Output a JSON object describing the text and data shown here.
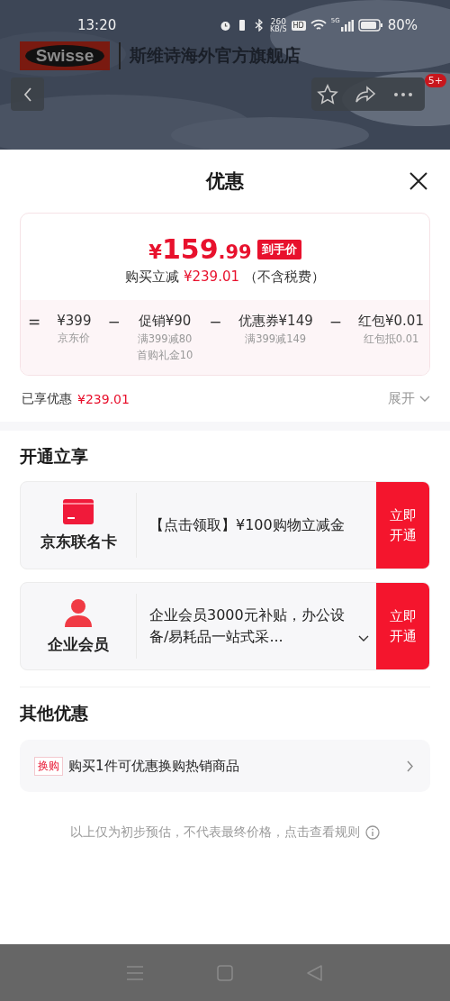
{
  "status_bar": {
    "time": "13:20",
    "network_speed": "260",
    "speed_unit": "KB/S",
    "hd": "HD",
    "network": "5G",
    "battery": "80%"
  },
  "store_header": {
    "logo": "Swisse",
    "name": "斯维诗海外官方旗舰店",
    "badge": "5+"
  },
  "sheet": {
    "title": "优惠",
    "price": {
      "symbol": "¥",
      "integer": "159",
      "decimal": ".99",
      "tag": "到手价",
      "saving_label": "购买立减",
      "saving": "¥239.01",
      "note": "（不含税费）"
    },
    "breakdown": [
      {
        "operator": "=",
        "amount": "¥399",
        "details": [
          "京东价"
        ]
      },
      {
        "operator": "−",
        "label": "促销",
        "amount": "¥90",
        "details": [
          "满399减80",
          "首购礼金10"
        ]
      },
      {
        "operator": "−",
        "label": "优惠券",
        "amount": "¥149",
        "details": [
          "满399减149"
        ]
      },
      {
        "operator": "−",
        "label": "红包",
        "amount": "¥0.01",
        "details": [
          "红包抵0.01"
        ]
      }
    ],
    "enjoyed": {
      "label": "已享优惠",
      "amount": "¥239.01",
      "toggle": "展开"
    },
    "open_section": {
      "title": "开通立享",
      "offers": [
        {
          "kind": "card",
          "name": "京东联名卡",
          "description": "【点击领取】¥100购物立减金",
          "button": "立即开通",
          "expandable": false
        },
        {
          "kind": "member",
          "name": "企业会员",
          "description": "企业会员3000元补贴，办公设备/易耗品一站式采...",
          "button": "立即开通",
          "expandable": true
        }
      ]
    },
    "other_section": {
      "title": "其他优惠",
      "items": [
        {
          "tag": "换购",
          "text": "购买1件可优惠换购热销商品"
        }
      ]
    },
    "disclaimer": "以上仅为初步预估，不代表最终价格，点击查看规则"
  }
}
